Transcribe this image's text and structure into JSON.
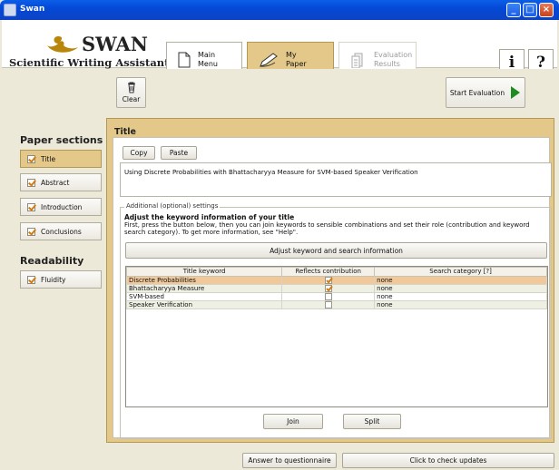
{
  "window": {
    "title": "Swan"
  },
  "logo": {
    "name": "SWAN",
    "subtitle": "Scientific Writing Assistant"
  },
  "nav": {
    "main_menu": "Main\nMenu",
    "my_paper": "My\nPaper",
    "evaluation_results": "Evaluation\nResults",
    "info_glyph": "i",
    "help_glyph": "?"
  },
  "toolbar": {
    "clear_label": "Clear",
    "start_label": "Start Evaluation"
  },
  "sidebar": {
    "paper_sections_heading": "Paper sections",
    "items": [
      {
        "label": "Title",
        "active": true
      },
      {
        "label": "Abstract",
        "active": false
      },
      {
        "label": "Introduction",
        "active": false
      },
      {
        "label": "Conclusions",
        "active": false
      }
    ],
    "readability_heading": "Readability",
    "readability_items": [
      {
        "label": "Fluidity"
      }
    ]
  },
  "main": {
    "title": "Title",
    "copy_label": "Copy",
    "paste_label": "Paste",
    "title_text": "Using Discrete Probabilities with Bhattacharyya Measure for SVM-based Speaker Verification",
    "settings_legend": "Additional (optional) settings",
    "settings_heading": "Adjust the keyword information of your title",
    "settings_text": "First, press the button below, then you can join keywords to sensible combinations and set their role (contribution and keyword search category). To get more information, see \"Help\".",
    "adjust_button": "Adjust keyword and search information",
    "table": {
      "headers": [
        "Title keyword",
        "Reflects contribution",
        "Search category [?]"
      ],
      "rows": [
        {
          "keyword": "Discrete Probabilities",
          "contribution": true,
          "category": "none"
        },
        {
          "keyword": "Bhattacharyya Measure",
          "contribution": true,
          "category": "none"
        },
        {
          "keyword": "SVM-based",
          "contribution": false,
          "category": "none"
        },
        {
          "keyword": "Speaker Verification",
          "contribution": false,
          "category": "none"
        }
      ]
    },
    "join_label": "Join",
    "split_label": "Split"
  },
  "footer": {
    "questionnaire_label": "Answer to questionnaire",
    "updates_label": "Click to check updates"
  },
  "colors": {
    "accent": "#e4c88a",
    "titlebar": "#0449d6",
    "selected_row": "#f0c89a"
  },
  "icons": [
    "swan-icon",
    "document-icon",
    "pen-icon",
    "results-icon",
    "trash-icon",
    "play-arrow-icon",
    "check-icon"
  ]
}
